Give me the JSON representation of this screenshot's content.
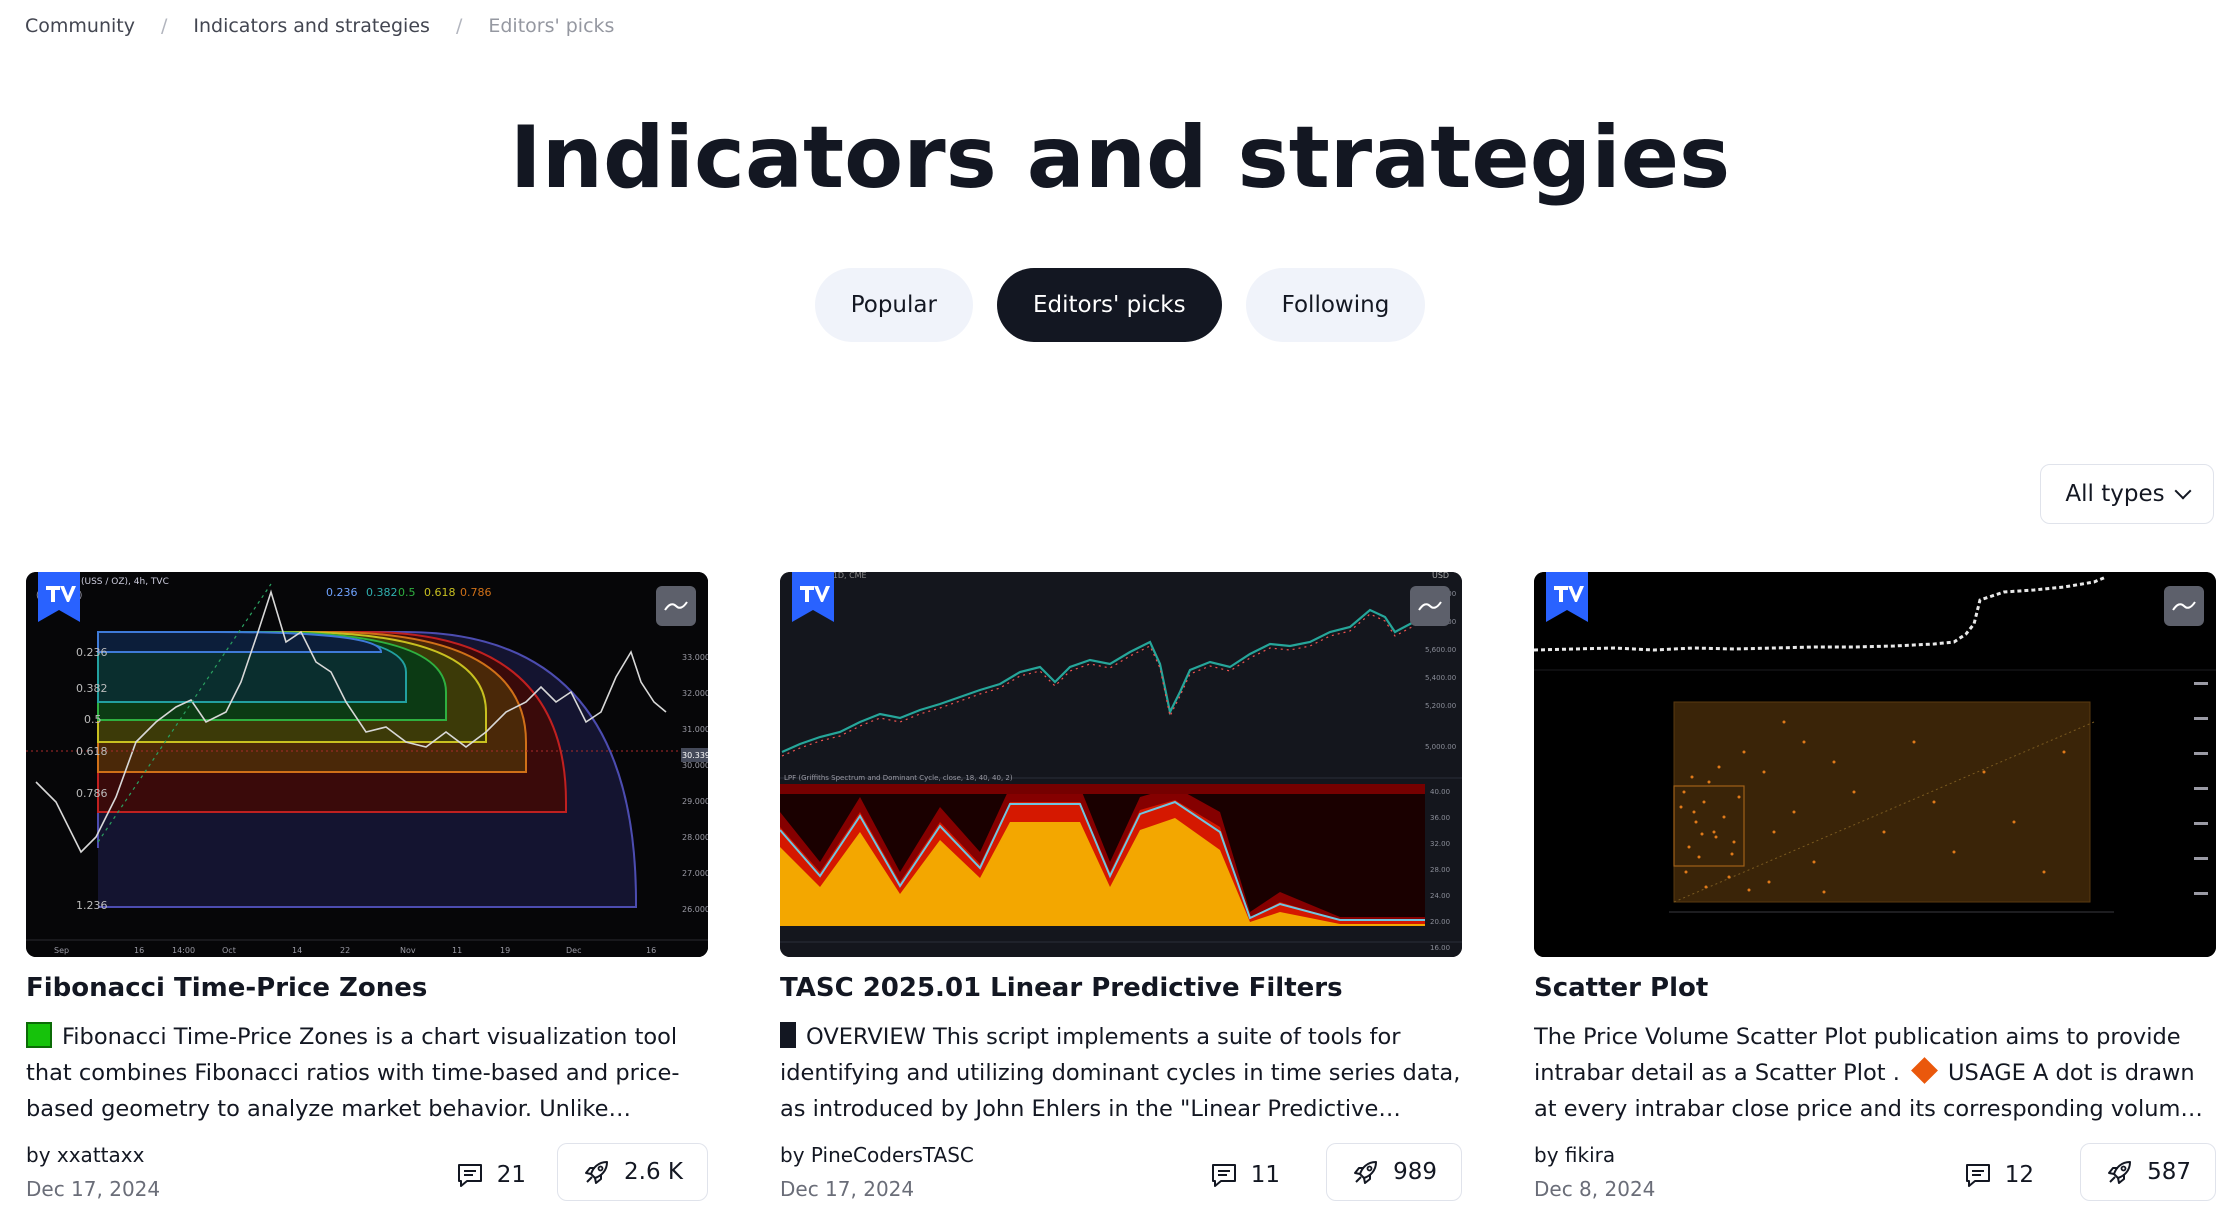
{
  "breadcrumb": {
    "items": [
      "Community",
      "Indicators and strategies",
      "Editors' picks"
    ],
    "separator": "/"
  },
  "title": "Indicators and strategies",
  "tabs": [
    {
      "label": "Popular",
      "active": false
    },
    {
      "label": "Editors' picks",
      "active": true
    },
    {
      "label": "Following",
      "active": false
    }
  ],
  "filter": {
    "label": "All types",
    "icon": "chevron-down-icon"
  },
  "cards": [
    {
      "title": "Fibonacci Time-Price Zones",
      "description": "Fibonacci Time-Price Zones is a chart visualization tool that combines Fibonacci ratios with time-based and price-based geometry to analyze market behavior. Unlike typical…",
      "description_icon": "green-square-icon",
      "author": "by xxattaxx",
      "date": "Dec 17, 2024",
      "comments": "21",
      "boosts": "2.6 K",
      "thumbnail": {
        "header": "(USS / OZ), 4h, TVC",
        "fib_levels": [
          "0.236",
          "0.382",
          "0.5",
          "0.618",
          "0.786",
          "1.236"
        ],
        "top_levels": [
          "0.236",
          "0.382",
          "0.5",
          "0.618",
          "0.786"
        ],
        "price_labels": [
          "33.0000",
          "32.0000",
          "31.0000",
          "30.0000",
          "29.0000",
          "28.0000",
          "27.0000",
          "26.0000"
        ],
        "price_tag": "30.3394",
        "months": [
          "Sep",
          "16",
          "14:00",
          "Oct",
          "14",
          "22",
          "Nov",
          "11",
          "19",
          "Dec",
          "16"
        ]
      }
    },
    {
      "title": "TASC 2025.01 Linear Predictive Filters",
      "description": "OVERVIEW This script implements a suite of tools for identifying and utilizing dominant cycles in time series data, as introduced by John Ehlers in the \"Linear Predictive Filters…",
      "description_icon": "black-square-icon",
      "author": "by PineCodersTASC",
      "date": "Dec 17, 2024",
      "comments": "11",
      "boosts": "989",
      "thumbnail": {
        "header": "Futures, 1D, CME",
        "currency": "USD",
        "price_labels": [
          "6,000.00",
          "5,800.00",
          "5,600.00",
          "5,400.00",
          "5,200.00",
          "5,000.00"
        ],
        "indicator_label": "LPF (Griffiths Spectrum and Dominant Cycle, close, 18, 40, 40, 2)",
        "indicator_labels": [
          "40.00",
          "36.00",
          "32.00",
          "28.00",
          "24.00",
          "20.00",
          "16.00"
        ]
      }
    },
    {
      "title": "Scatter Plot",
      "description": "The Price Volume Scatter Plot publication aims to provide intrabar detail as a Scatter Plot . USAGE A dot is drawn at every intrabar close price and its corresponding volume , as…",
      "description_icon": "orange-diamond-icon",
      "author": "by fikira",
      "date": "Dec 8, 2024",
      "comments": "12",
      "boosts": "587"
    }
  ],
  "colors": {
    "text": "#131722",
    "muted": "#6a6d78",
    "tab_bg": "#f0f3fa",
    "tab_active_bg": "#131722",
    "tv_blue": "#2962ff",
    "border": "#e0e3eb"
  }
}
